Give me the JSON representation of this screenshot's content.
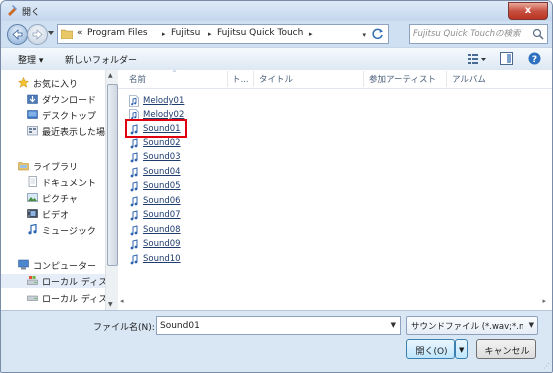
{
  "window": {
    "title": "開く",
    "close_glyph": "x"
  },
  "address": {
    "overflow": "«",
    "segments": [
      "Program Files",
      "Fujitsu",
      "Fujitsu Quick Touch"
    ]
  },
  "search": {
    "placeholder": "Fujitsu Quick Touchの検索"
  },
  "toolbar": {
    "organize_label": "整理 ▾",
    "new_folder_label": "新しいフォルダー"
  },
  "nav": {
    "items": [
      {
        "label": "お気に入り",
        "icon": "star-icon"
      },
      {
        "label": "ダウンロード",
        "icon": "downloads-folder-icon"
      },
      {
        "label": "デスクトップ",
        "icon": "desktop-icon"
      },
      {
        "label": "最近表示した場",
        "icon": "recent-places-icon"
      },
      {
        "label": "ライブラリ",
        "icon": "library-icon"
      },
      {
        "label": "ドキュメント",
        "icon": "documents-icon"
      },
      {
        "label": "ピクチャ",
        "icon": "pictures-icon"
      },
      {
        "label": "ビデオ",
        "icon": "videos-icon"
      },
      {
        "label": "ミュージック",
        "icon": "music-icon"
      },
      {
        "label": "コンピューター",
        "icon": "computer-icon"
      },
      {
        "label": "ローカル ディス",
        "icon": "local-disk-icon"
      },
      {
        "label": "ローカル ディス",
        "icon": "local-disk-icon"
      }
    ]
  },
  "columns": {
    "name": "名前",
    "track": "ト...",
    "title": "タイトル",
    "artist": "参加アーティスト",
    "album": "アルバム"
  },
  "files": [
    {
      "name": "Melody01",
      "icon": "audio-file-icon"
    },
    {
      "name": "Melody02",
      "icon": "audio-file-icon"
    },
    {
      "name": "Sound01",
      "icon": "audio-file-icon"
    },
    {
      "name": "Sound02",
      "icon": "audio-file-icon"
    },
    {
      "name": "Sound03",
      "icon": "audio-file-icon"
    },
    {
      "name": "Sound04",
      "icon": "audio-file-icon"
    },
    {
      "name": "Sound05",
      "icon": "audio-file-icon"
    },
    {
      "name": "Sound06",
      "icon": "audio-file-icon"
    },
    {
      "name": "Sound07",
      "icon": "audio-file-icon"
    },
    {
      "name": "Sound08",
      "icon": "audio-file-icon"
    },
    {
      "name": "Sound09",
      "icon": "audio-file-icon"
    },
    {
      "name": "Sound10",
      "icon": "audio-file-icon"
    }
  ],
  "highlighted_file": "Sound01",
  "footer": {
    "filename_label": "ファイル名(N):",
    "filename_value": "Sound01",
    "filetype_value": "サウンドファイル (*.wav;*.m",
    "open_label": "開く(O)",
    "cancel_label": "キャンセル"
  },
  "colors": {
    "highlight_border": "#e00010",
    "accent": "#3c7fb1",
    "close_red": "#c85040"
  }
}
